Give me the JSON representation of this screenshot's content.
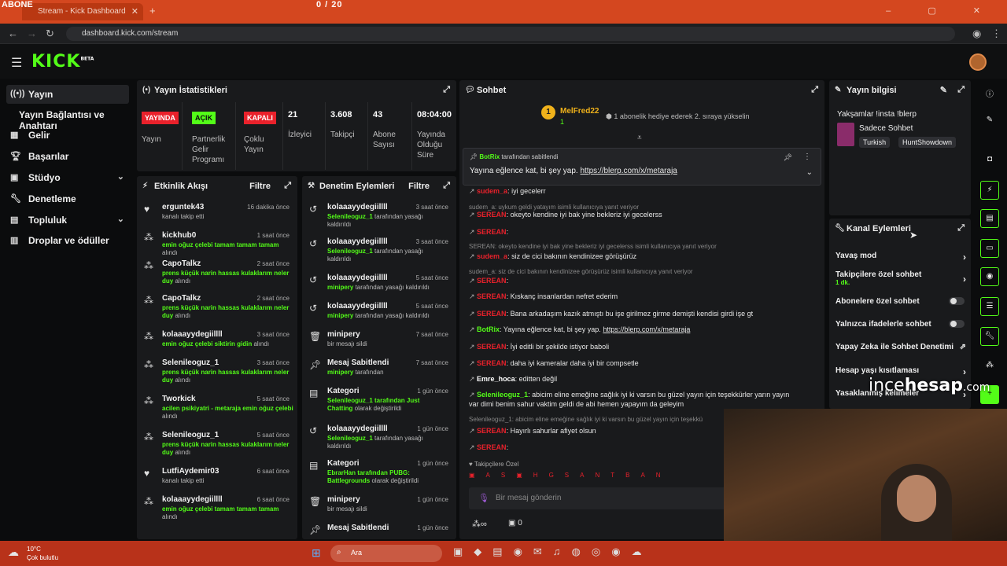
{
  "browser": {
    "overlay_left": "ABONE",
    "overlay_counter": "0 / 20",
    "tab_title": "Stream - Kick Dashboard",
    "url": "dashboard.kick.com/stream"
  },
  "brand": {
    "logo": "KICK",
    "beta": "BETA",
    "accent": "#53fc18"
  },
  "sidebar": {
    "items": [
      {
        "label": "Yayın",
        "icon": "broadcast-icon"
      },
      {
        "label": "Yayın Bağlantısı ve Anahtarı"
      },
      {
        "label": "Gelir",
        "icon": "revenue-icon"
      },
      {
        "label": "Başarılar",
        "icon": "trophy-icon"
      },
      {
        "label": "Stüdyo",
        "icon": "studio-icon"
      },
      {
        "label": "Denetleme",
        "icon": "wrench-icon"
      },
      {
        "label": "Topluluk",
        "icon": "community-icon"
      },
      {
        "label": "Droplar ve ödüller",
        "icon": "drops-icon"
      }
    ]
  },
  "stats": {
    "title": "Yayın İstatistikleri",
    "items": [
      {
        "value": "YAYINDA",
        "label": "Yayın"
      },
      {
        "value": "AÇIK",
        "label": "Partnerlik Gelir Programı"
      },
      {
        "value": "KAPALI",
        "label": "Çoklu Yayın"
      },
      {
        "value": "21",
        "label": "İzleyici"
      },
      {
        "value": "3.608",
        "label": "Takipçi"
      },
      {
        "value": "43",
        "label": "Abone Sayısı"
      },
      {
        "value": "08:04:00",
        "label": "Yayında Olduğu Süre"
      }
    ]
  },
  "activity": {
    "title": "Etkinlik Akışı",
    "filter": "Filtre",
    "items": [
      {
        "name": "erguntek43",
        "time": "16 dakika önce",
        "desc": "kanalı takip etti",
        "hl": ""
      },
      {
        "name": "kickhub0",
        "time": "1 saat önce",
        "hl": "emin oğuz çelebi tamam tamam tamam",
        "desc": "alındı"
      },
      {
        "name": "CapoTalkz",
        "time": "2 saat önce",
        "hl": "prens küçük narin hassas kulaklarım neler duy",
        "desc": "alındı"
      },
      {
        "name": "CapoTalkz",
        "time": "2 saat önce",
        "hl": "prens küçük narin hassas kulaklarım neler duy",
        "desc": "alındı"
      },
      {
        "name": "kolaaayydegiillll",
        "time": "3 saat önce",
        "hl": "emin oğuz çelebi siktirin gidin",
        "desc": "alındı"
      },
      {
        "name": "Selenileoguz_1",
        "time": "3 saat önce",
        "hl": "prens küçük narin hassas kulaklarım neler duy",
        "desc": "alındı"
      },
      {
        "name": "Tworkick",
        "time": "5 saat önce",
        "hl": "acilen psikiyatri - metaraja emin oğuz çelebi",
        "desc": "alındı"
      },
      {
        "name": "Selenileoguz_1",
        "time": "5 saat önce",
        "hl": "prens küçük narin hassas kulaklarım neler duy",
        "desc": "alındı"
      },
      {
        "name": "LutfiAydemir03",
        "time": "6 saat önce",
        "desc": "kanalı takip etti",
        "hl": ""
      },
      {
        "name": "kolaaayydegiillll",
        "time": "6 saat önce",
        "hl": "emin oğuz çelebi tamam tamam tamam",
        "desc": "alındı"
      }
    ]
  },
  "moderation": {
    "title": "Denetim Eylemleri",
    "filter": "Filtre",
    "items": [
      {
        "name": "kolaaayydegiillll",
        "time": "3 saat önce",
        "hl": "Selenileoguz_1",
        "desc": "tarafından yasağı kaldırıldı"
      },
      {
        "name": "kolaaayydegiillll",
        "time": "3 saat önce",
        "hl": "Selenileoguz_1",
        "desc": "tarafından yasağı kaldırıldı"
      },
      {
        "name": "kolaaayydegiillll",
        "time": "5 saat önce",
        "hl": "minipery",
        "desc": "tarafından yasağı kaldırıldı"
      },
      {
        "name": "kolaaayydegiillll",
        "time": "5 saat önce",
        "hl": "minipery",
        "desc": "tarafından yasağı kaldırıldı"
      },
      {
        "name": "minipery",
        "time": "7 saat önce",
        "hl": "",
        "desc": "bir mesajı sildi"
      },
      {
        "name": "Mesaj Sabitlendi",
        "time": "7 saat önce",
        "hl": "minipery",
        "desc": "tarafından"
      },
      {
        "name": "Kategori",
        "time": "1 gün önce",
        "hl": "Selenileoguz_1 tarafından Just Chatting",
        "desc": "olarak değiştirildi"
      },
      {
        "name": "kolaaayydegiillll",
        "time": "1 gün önce",
        "hl": "Selenileoguz_1",
        "desc": "tarafından yasağı kaldırıldı"
      },
      {
        "name": "Kategori",
        "time": "1 gün önce",
        "hl": "EbrarHan tarafından PUBG: Battlegrounds",
        "desc": "olarak değiştirildi"
      },
      {
        "name": "minipery",
        "time": "1 gün önce",
        "hl": "",
        "desc": "bir mesajı sildi"
      },
      {
        "name": "Mesaj Sabitlendi",
        "time": "1 gün önce",
        "hl": "",
        "desc": ""
      }
    ]
  },
  "chat": {
    "title": "Sohbet",
    "top_gifter": {
      "rank": "1",
      "name": "MelFred22",
      "count": "1",
      "note": "1 abonelik hediye ederek 2. sıraya yükselin"
    },
    "pinned": {
      "by": "BotRix",
      "by_suffix": "tarafından sabitlendi",
      "text": "Yayına eğlence kat, bi şey yap.",
      "link": "https://blerp.com/x/metaraja"
    },
    "lines": [
      {
        "reply": "",
        "user": "sudem_a",
        "color": "#e9212b",
        "text": ": iyi gecelerr"
      },
      {
        "reply": "sudem_a: uykum geldi yatayım isimli kullanıcıya yanıt veriyor",
        "user": "",
        "color": "",
        "text": ""
      },
      {
        "reply": "",
        "user": "SEREAN",
        "color": "#e9212b",
        "text": ": okeyto kendine iyi bak yine bekleriz iyi gecelerss"
      },
      {
        "reply": "",
        "user": "SEREAN",
        "color": "#e9212b",
        "text": ":"
      },
      {
        "reply": "SEREAN: okeyto kendine iyi bak yine bekleriz iyi gecelerss isimli kullanıcıya yanıt veriyor",
        "user": "",
        "color": "",
        "text": ""
      },
      {
        "reply": "",
        "user": "sudem_a",
        "color": "#e9212b",
        "text": ": siz de cici bakının kendinizee görüşürüz"
      },
      {
        "reply": "sudem_a: siz de cici bakının kendinizee görüşürüz isimli kullanıcıya yanıt veriyor",
        "user": "",
        "color": "",
        "text": ""
      },
      {
        "reply": "",
        "user": "SEREAN",
        "color": "#e9212b",
        "text": ":"
      },
      {
        "reply": "",
        "user": "SEREAN",
        "color": "#e9212b",
        "text": ": Kıskanç insanlardan nefret ederim"
      },
      {
        "reply": "",
        "user": "SEREAN",
        "color": "#e9212b",
        "text": ": Bana arkadaşım kazık atmıştı bu işe girilmez girme demişti kendisi girdi işe gt"
      },
      {
        "reply": "",
        "user": "BotRix",
        "color": "#53fc18",
        "text": ": Yayına eğlence kat, bi şey yap.",
        "link": "https://blerp.com/x/metaraja"
      },
      {
        "reply": "",
        "user": "SEREAN",
        "color": "#e9212b",
        "text": ": İyi editli bir şekilde istiyor baboli"
      },
      {
        "reply": "",
        "user": "SEREAN",
        "color": "#e9212b",
        "text": ": daha iyi kameralar daha iyi bir compsetle"
      },
      {
        "reply": "",
        "user": "Emre_hoca",
        "color": "#ffffff",
        "text": ": editten değil"
      },
      {
        "reply": "",
        "user": "Selenileoguz_1",
        "color": "#53fc18",
        "text": ": abicim eline emeğine sağlık iyi ki varsın bu güzel yayın için teşekkürler yarın yayın"
      },
      {
        "reply": "",
        "user": "",
        "color": "",
        "text": "var dimi benim sahur vaktim geldi de abi hemen yapayım da geleyim"
      },
      {
        "reply": "Selenileoguz_1: abicim eline emeğine sağlık iyi ki varsın bu güzel yayın için teşekkü",
        "user": "",
        "color": "",
        "text": ""
      },
      {
        "reply": "",
        "user": "SEREAN",
        "color": "#e9212b",
        "text": ": Hayırlı sahurlar afiyet olsun"
      },
      {
        "reply": "",
        "user": "SEREAN",
        "color": "#e9212b",
        "text": ":"
      }
    ],
    "followers_only": "Takipçilere Özel",
    "input_placeholder": "Bir mesaj gönderin",
    "points": "0"
  },
  "stream_info": {
    "title": "Yayın bilgisi",
    "stream_title": "Yakşamlar !insta !blerp",
    "category": "Sadece Sohbet",
    "tags": [
      "Turkish",
      "HuntShowdown"
    ]
  },
  "channel_actions": {
    "title": "Kanal Eylemleri",
    "rows": [
      {
        "label": "Yavaş mod",
        "kind": "arrow"
      },
      {
        "label": "Takipçilere özel sohbet",
        "sub": "1 dk.",
        "kind": "arrow"
      },
      {
        "label": "Abonelere özel sohbet",
        "kind": "toggle"
      },
      {
        "label": "Yalnızca ifadelerle sohbet",
        "kind": "toggle"
      },
      {
        "label": "Yapay Zeka ile Sohbet Denetimi",
        "kind": "external"
      },
      {
        "label": "Hesap yaşı kısıtlaması",
        "kind": "arrow"
      },
      {
        "label": "Yasaklanmış kelimeler",
        "kind": "arrow"
      }
    ]
  },
  "watermark": {
    "a": "ince",
    "b": "hesap",
    "c": ".com"
  },
  "taskbar": {
    "temp": "10°C",
    "weather": "Çok bulutlu",
    "search": "Ara"
  }
}
